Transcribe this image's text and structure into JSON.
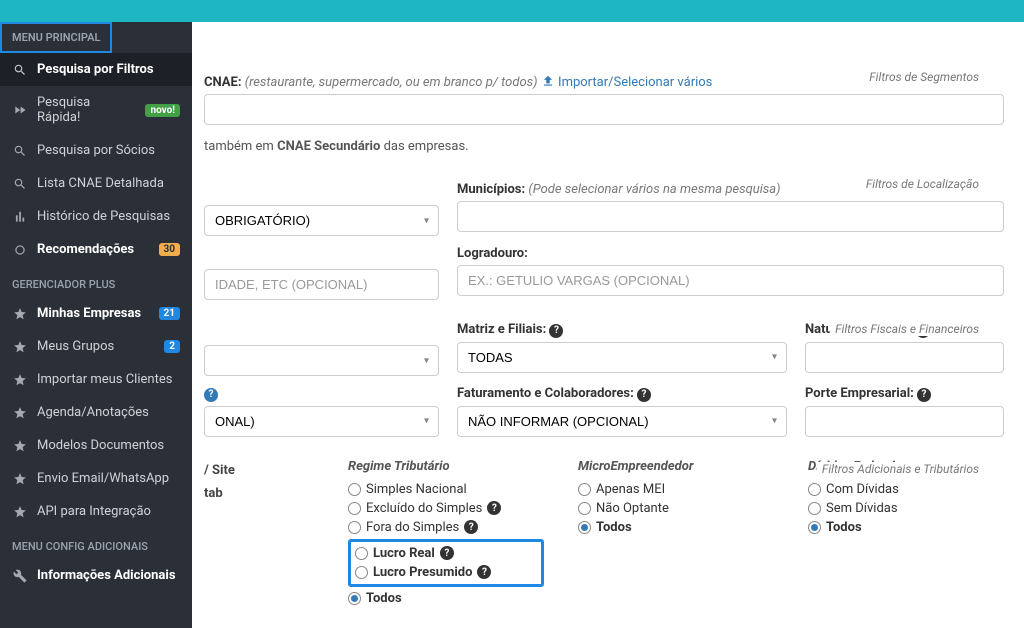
{
  "sidebar": {
    "header": "MENU PRINCIPAL",
    "section2": "GERENCIADOR PLUS",
    "section3": "MENU CONFIG ADICIONAIS",
    "items1": [
      {
        "label": "Pesquisa por Filtros"
      },
      {
        "label": "Pesquisa Rápida!",
        "badge": "novo!"
      },
      {
        "label": "Pesquisa por Sócios"
      },
      {
        "label": "Lista CNAE Detalhada"
      },
      {
        "label": "Histórico de Pesquisas"
      },
      {
        "label": "Recomendações",
        "badge": "30"
      }
    ],
    "items2": [
      {
        "label": "Minhas Empresas",
        "badge": "21"
      },
      {
        "label": "Meus Grupos",
        "badge": "2"
      },
      {
        "label": "Importar meus Clientes"
      },
      {
        "label": "Agenda/Anotações"
      },
      {
        "label": "Modelos Documentos"
      },
      {
        "label": "Envio Email/WhatsApp"
      },
      {
        "label": "API para Integração"
      }
    ],
    "items3": [
      {
        "label": "Informações Adicionais"
      }
    ]
  },
  "fieldsets": {
    "segmentos": "Filtros de Segmentos",
    "localizacao": "Filtros de Localização",
    "fiscais": "Filtros Fiscais e Financeiros",
    "adicionais": "Filtros Adicionais e Tributários"
  },
  "cnae": {
    "label": "CNAE:",
    "hint": "(restaurante, supermercado, ou em branco p/ todos)",
    "import_link": "Importar/Selecionar vários",
    "secondary_prefix": "também em",
    "secondary_bold": "CNAE Secundário",
    "secondary_suffix": "das empresas."
  },
  "loc": {
    "municipios_label": "Municípios:",
    "municipios_hint": "(Pode selecionar vários na mesma pesquisa)",
    "uf_placeholder": "OBRIGATÓRIO)",
    "logradouro_label": "Logradouro:",
    "bairro_placeholder": "IDADE, ETC (OPCIONAL)",
    "logradouro_placeholder": "EX.: GETULIO VARGAS (OPCIONAL)"
  },
  "fisc": {
    "matriz_label": "Matriz e Filiais:",
    "matriz_value": "TODAS",
    "natureza_label": "Natureza Jurídica:",
    "capital_placeholder": "ONAL)",
    "fat_label": "Faturamento e Colaboradores:",
    "fat_value": "NÃO INFORMAR (OPCIONAL)",
    "porte_label": "Porte Empresarial:"
  },
  "adic": {
    "contact_items": [
      "/ Site",
      "tab"
    ],
    "regime": {
      "title": "Regime Tributário",
      "opts": [
        "Simples Nacional",
        "Excluído do Simples",
        "Fora do Simples",
        "Lucro Real",
        "Lucro Presumido",
        "Todos"
      ],
      "selected": "Todos"
    },
    "mei": {
      "title": "MicroEmpreendedor",
      "opts": [
        "Apenas MEI",
        "Não Optante",
        "Todos"
      ],
      "selected": "Todos"
    },
    "dividas": {
      "title": "Dívidas Federais",
      "opts": [
        "Com Dívidas",
        "Sem Dívidas",
        "Todos"
      ],
      "selected": "Todos"
    }
  }
}
